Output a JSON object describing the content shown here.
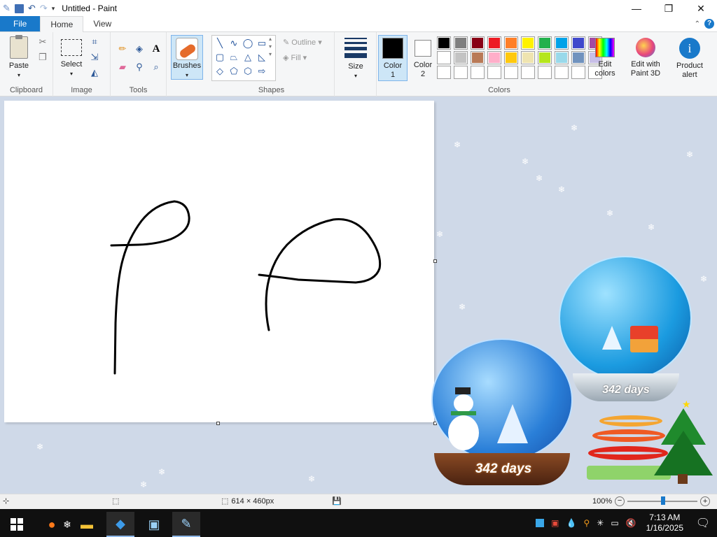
{
  "window": {
    "title": "Untitled - Paint",
    "minimize": "—",
    "maximize": "❐",
    "close": "✕"
  },
  "quick_access": {
    "save_icon": "save-icon",
    "undo_icon": "undo-icon",
    "redo_icon": "redo-icon"
  },
  "tabs": [
    {
      "label": "File"
    },
    {
      "label": "Home"
    },
    {
      "label": "View"
    }
  ],
  "ribbon": {
    "clipboard": {
      "label": "Clipboard",
      "paste": "Paste"
    },
    "image": {
      "label": "Image",
      "select": "Select"
    },
    "tools": {
      "label": "Tools"
    },
    "brushes": {
      "label": "Brushes"
    },
    "shapes": {
      "label": "Shapes",
      "outline": "Outline",
      "fill": "Fill"
    },
    "size": {
      "label": "Size"
    },
    "colors": {
      "label": "Colors",
      "color1": "Color 1",
      "color2": "Color 2",
      "edit_colors": "Edit colors",
      "edit_3d": "Edit with Paint 3D",
      "product_alert": "Product alert",
      "palette_row1": [
        "#000000",
        "#7f7f7f",
        "#880015",
        "#ed1c24",
        "#ff7f27",
        "#fff200",
        "#22b14c",
        "#00a2e8",
        "#3f48cc",
        "#a349a4"
      ],
      "palette_row2": [
        "#ffffff",
        "#c3c3c3",
        "#b97a57",
        "#ffaec9",
        "#ffc90e",
        "#efe4b0",
        "#b5e61d",
        "#99d9ea",
        "#7092be",
        "#c8bfe7"
      ],
      "palette_row3": [
        "#ffffff",
        "#ffffff",
        "#ffffff",
        "#ffffff",
        "#ffffff",
        "#ffffff",
        "#ffffff",
        "#ffffff",
        "#ffffff",
        "#ffffff"
      ]
    }
  },
  "status": {
    "canvas_size": "614 × 460px",
    "zoom": "100%"
  },
  "desktop": {
    "globe_left_label": "342 days",
    "globe_right_label": "342 days"
  },
  "taskbar": {
    "time": "7:13 AM",
    "date": "1/16/2025"
  }
}
